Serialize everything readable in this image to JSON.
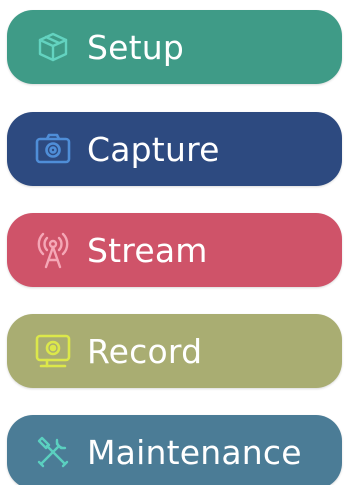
{
  "menu": {
    "items": [
      {
        "label": "Setup",
        "icon": "setup-icon",
        "bg_color": "#3f9b87",
        "icon_color": "#63d3c0"
      },
      {
        "label": "Capture",
        "icon": "camera-icon",
        "bg_color": "#2d4a80",
        "icon_color": "#4f8ed8"
      },
      {
        "label": "Stream",
        "icon": "broadcast-icon",
        "bg_color": "#cf5369",
        "icon_color": "#f5a7b6"
      },
      {
        "label": "Record",
        "icon": "record-icon",
        "bg_color": "#a9ad72",
        "icon_color": "#dce84a"
      },
      {
        "label": "Maintenance",
        "icon": "tools-icon",
        "bg_color": "#4b7c96",
        "icon_color": "#5bd0c0"
      }
    ]
  }
}
